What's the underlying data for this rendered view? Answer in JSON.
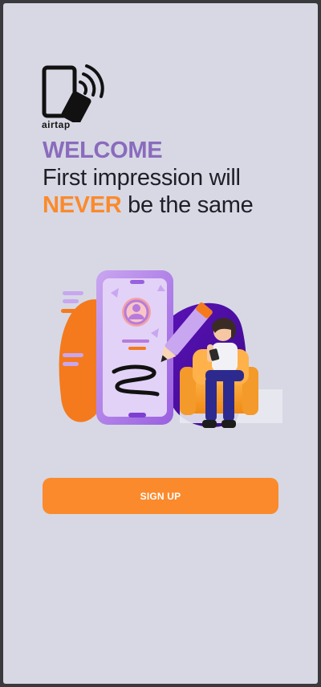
{
  "brand": {
    "logo_text": "airtap",
    "logo_icon": "nfc-card-tap-icon"
  },
  "headline": {
    "welcome": "WELCOME",
    "line2": "First impression will",
    "never": "NEVER",
    "line3_rest": " be the same"
  },
  "illustration": {
    "icon": "phone-woman-armchair-illustration"
  },
  "actions": {
    "signup_label": "SIGN UP"
  },
  "colors": {
    "background": "#d7d8e4",
    "accent_orange": "#fb8a2c",
    "accent_purple": "#8a6bbd",
    "text_dark": "#1e1f26"
  }
}
